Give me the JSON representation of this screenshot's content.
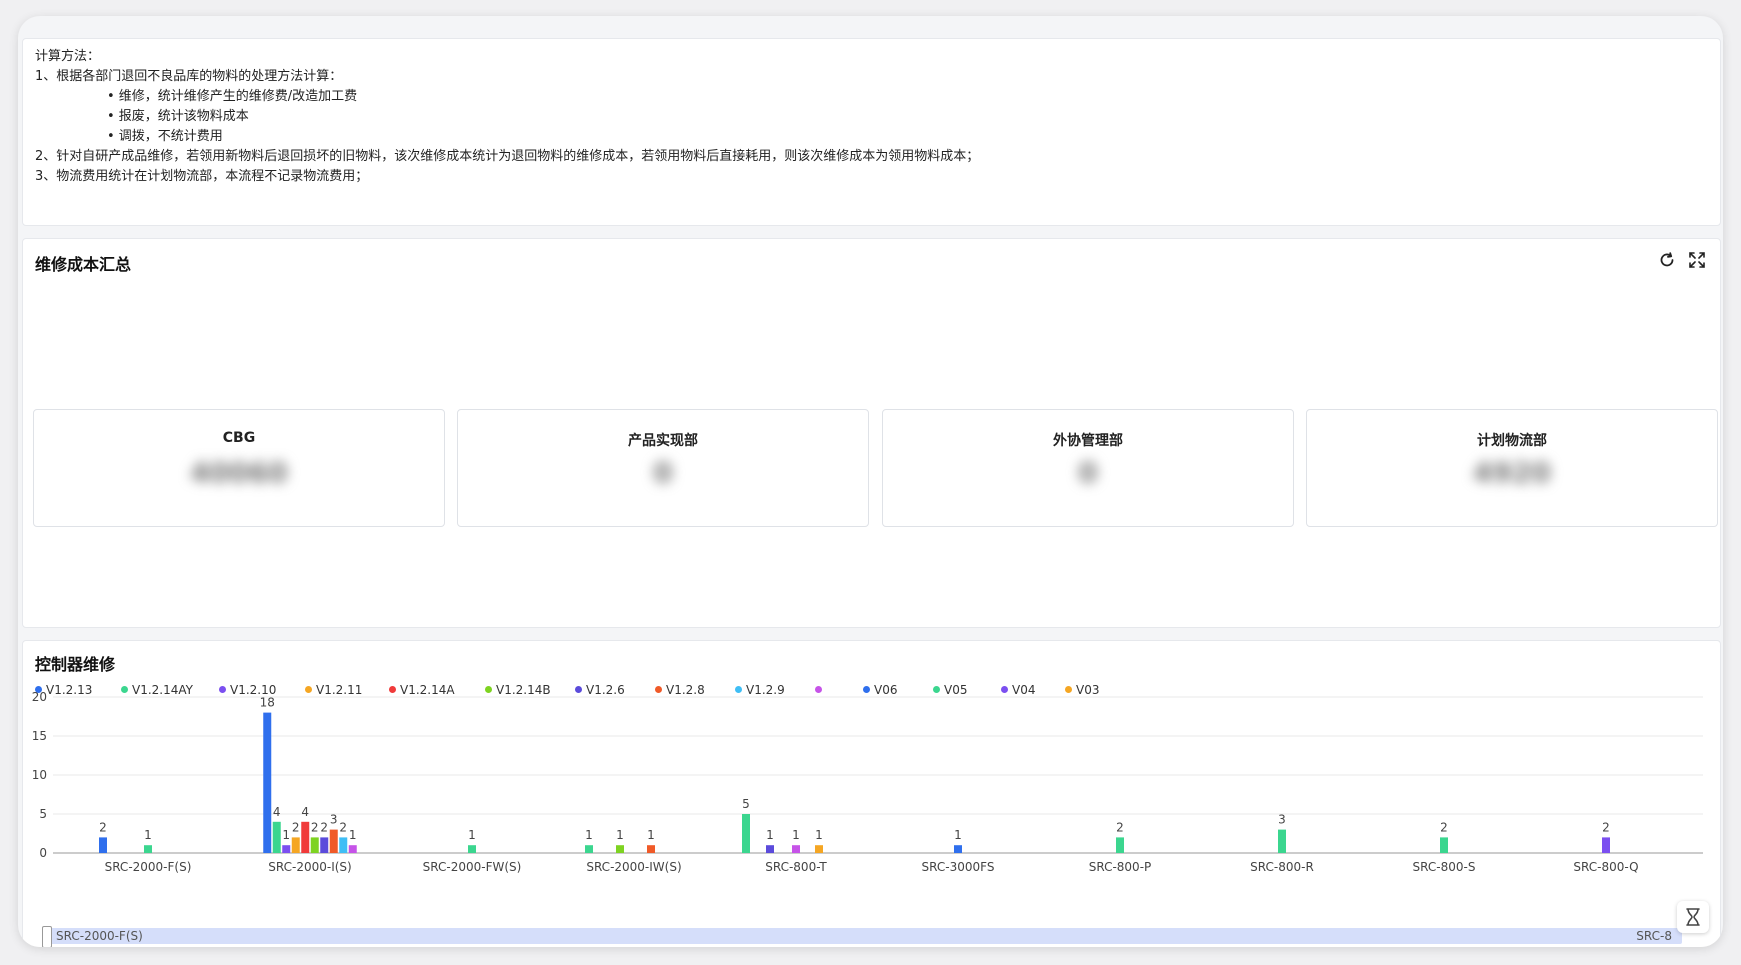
{
  "method": {
    "lines": [
      "计算方法：",
      "1、根据各部门退回不良品库的物料的处理方法计算：",
      "• 维修，统计维修产生的维修费/改造加工费",
      "• 报废，统计该物料成本",
      "• 调拨，不统计费用",
      "2、针对自研产成品维修，若领用新物料后退回损坏的旧物料，该次维修成本统计为退回物料的维修成本，若领用物料后直接耗用，则该次维修成本为领用物料成本；",
      "3、物流费用统计在计划物流部，本流程不记录物流费用；"
    ]
  },
  "summary": {
    "title": "维修成本汇总",
    "cards": [
      {
        "label": "CBG",
        "value": "40060"
      },
      {
        "label": "产品实现部",
        "value": "0"
      },
      {
        "label": "外协管理部",
        "value": "0"
      },
      {
        "label": "计划物流部",
        "value": "4920"
      }
    ]
  },
  "chart_panel": {
    "title": "控制器维修",
    "slider_start": "SRC-2000-F(S)",
    "slider_end": "SRC-8"
  },
  "chart_data": {
    "type": "bar",
    "categories": [
      "SRC-2000-F(S)",
      "SRC-2000-I(S)",
      "SRC-2000-FW(S)",
      "SRC-2000-IW(S)",
      "SRC-800-T",
      "SRC-3000FS",
      "SRC-800-P",
      "SRC-800-R",
      "SRC-800-S",
      "SRC-800-Q"
    ],
    "ylim": [
      0,
      20
    ],
    "yticks": [
      0,
      5,
      10,
      15,
      20
    ],
    "series": [
      {
        "name": "V1.2.13",
        "color": "#2f6fed",
        "values": [
          2,
          18,
          0,
          0,
          0,
          1,
          0,
          0,
          0,
          0
        ]
      },
      {
        "name": "V1.2.14AY",
        "color": "#3bd68f",
        "values": [
          1,
          4,
          1,
          1,
          5,
          0,
          0,
          0,
          0,
          0
        ]
      },
      {
        "name": "V1.2.10",
        "color": "#7b4ff0",
        "values": [
          0,
          1,
          0,
          0,
          0,
          0,
          0,
          0,
          0,
          0
        ]
      },
      {
        "name": "V1.2.11",
        "color": "#f5a623",
        "values": [
          0,
          2,
          0,
          0,
          0,
          0,
          0,
          0,
          0,
          0
        ]
      },
      {
        "name": "V1.2.14A",
        "color": "#f03a3a",
        "values": [
          0,
          4,
          0,
          0,
          0,
          0,
          0,
          0,
          0,
          0
        ]
      },
      {
        "name": "V1.2.14B",
        "color": "#7ed321",
        "values": [
          0,
          2,
          0,
          1,
          0,
          0,
          0,
          0,
          0,
          0
        ]
      },
      {
        "name": "V1.2.6",
        "color": "#5b4bdb",
        "values": [
          0,
          2,
          0,
          0,
          1,
          0,
          0,
          0,
          0,
          0
        ]
      },
      {
        "name": "V1.2.8",
        "color": "#f05a28",
        "values": [
          0,
          3,
          0,
          1,
          0,
          0,
          0,
          0,
          0,
          0
        ]
      },
      {
        "name": "V1.2.9",
        "color": "#3fbef5",
        "values": [
          0,
          2,
          0,
          0,
          0,
          0,
          0,
          0,
          0,
          0
        ]
      },
      {
        "name": "",
        "color": "#c653e8",
        "values": [
          0,
          1,
          0,
          0,
          1,
          0,
          0,
          0,
          0,
          0
        ]
      },
      {
        "name": "V06",
        "color": "#2f6fed",
        "values": [
          0,
          0,
          0,
          0,
          0,
          0,
          0,
          0,
          0,
          0
        ]
      },
      {
        "name": "V05",
        "color": "#3bd68f",
        "values": [
          0,
          0,
          0,
          0,
          0,
          0,
          2,
          3,
          2,
          0
        ]
      },
      {
        "name": "V04",
        "color": "#7b4ff0",
        "values": [
          0,
          0,
          0,
          0,
          0,
          0,
          0,
          0,
          0,
          2
        ]
      },
      {
        "name": "V03",
        "color": "#f5a623",
        "values": [
          0,
          0,
          0,
          0,
          1,
          0,
          0,
          0,
          0,
          0
        ]
      }
    ]
  }
}
